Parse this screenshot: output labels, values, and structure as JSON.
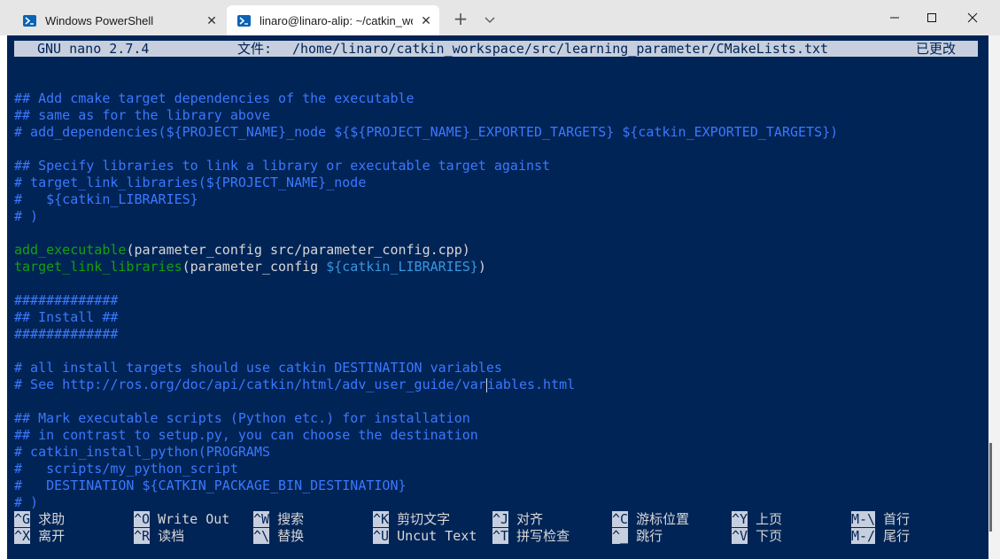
{
  "tabs": [
    {
      "label": "Windows PowerShell",
      "icon": "powershell-icon",
      "active": false
    },
    {
      "label": "linaro@linaro-alip: ~/catkin_wo",
      "icon": "powershell-icon",
      "active": true
    }
  ],
  "window_controls": {
    "new_tab": "+",
    "close_tab": "✕"
  },
  "nano": {
    "version": "GNU nano 2.7.4",
    "file_label": "文件:",
    "file_path": "/home/linaro/catkin_workspace/src/learning_parameter/CMakeLists.txt",
    "status": "已更改"
  },
  "editor_lines": [
    {
      "type": "blank",
      "text": ""
    },
    {
      "type": "comment",
      "text": "## Add cmake target dependencies of the executable"
    },
    {
      "type": "comment",
      "text": "## same as for the library above"
    },
    {
      "type": "comment",
      "text": "# add_dependencies(${PROJECT_NAME}_node ${${PROJECT_NAME}_EXPORTED_TARGETS} ${catkin_EXPORTED_TARGETS})"
    },
    {
      "type": "blank",
      "text": ""
    },
    {
      "type": "comment",
      "text": "## Specify libraries to link a library or executable target against"
    },
    {
      "type": "comment",
      "text": "# target_link_libraries(${PROJECT_NAME}_node"
    },
    {
      "type": "comment",
      "text": "#   ${catkin_LIBRARIES}"
    },
    {
      "type": "comment",
      "text": "# )"
    },
    {
      "type": "blank",
      "text": ""
    },
    {
      "type": "code",
      "func": "add_executable",
      "rest": "(parameter_config src/parameter_config.cpp)",
      "var": "",
      "tail": ""
    },
    {
      "type": "code",
      "func": "target_link_libraries",
      "rest": "(parameter_config ",
      "var": "${catkin_LIBRARIES}",
      "tail": ")"
    },
    {
      "type": "blank",
      "text": ""
    },
    {
      "type": "comment",
      "text": "#############"
    },
    {
      "type": "comment",
      "text": "## Install ##"
    },
    {
      "type": "comment",
      "text": "#############"
    },
    {
      "type": "blank",
      "text": ""
    },
    {
      "type": "comment",
      "text": "# all install targets should use catkin DESTINATION variables"
    },
    {
      "type": "cursor",
      "before": "# See http://ros.org/doc/api/catkin/html/adv_user_guide/var",
      "after": "iables.html"
    },
    {
      "type": "blank",
      "text": ""
    },
    {
      "type": "comment",
      "text": "## Mark executable scripts (Python etc.) for installation"
    },
    {
      "type": "comment",
      "text": "## in contrast to setup.py, you can choose the destination"
    },
    {
      "type": "comment",
      "text": "# catkin_install_python(PROGRAMS"
    },
    {
      "type": "comment",
      "text": "#   scripts/my_python_script"
    },
    {
      "type": "comment",
      "text": "#   DESTINATION ${CATKIN_PACKAGE_BIN_DESTINATION}"
    },
    {
      "type": "comment",
      "text": "# )"
    }
  ],
  "shortcuts": [
    [
      {
        "key": "^G",
        "label": "求助"
      },
      {
        "key": "^O",
        "label": "Write Out"
      },
      {
        "key": "^W",
        "label": "搜索"
      },
      {
        "key": "^K",
        "label": "剪切文字"
      },
      {
        "key": "^J",
        "label": "对齐"
      },
      {
        "key": "^C",
        "label": "游标位置"
      },
      {
        "key": "^Y",
        "label": "上页"
      },
      {
        "key": "M-\\",
        "label": "首行"
      }
    ],
    [
      {
        "key": "^X",
        "label": "离开"
      },
      {
        "key": "^R",
        "label": "读档"
      },
      {
        "key": "^\\",
        "label": "替换"
      },
      {
        "key": "^U",
        "label": "Uncut Text"
      },
      {
        "key": "^T",
        "label": "拼写检查"
      },
      {
        "key": "^_",
        "label": "跳行"
      },
      {
        "key": "^V",
        "label": "下页"
      },
      {
        "key": "M-/",
        "label": "尾行"
      }
    ]
  ],
  "colors": {
    "terminal_bg": "#012456",
    "comment": "#3b78ff",
    "function": "#13a10e",
    "variable": "#3a96dd",
    "text": "#d7d7d7",
    "header_bg": "#c7cfde"
  }
}
